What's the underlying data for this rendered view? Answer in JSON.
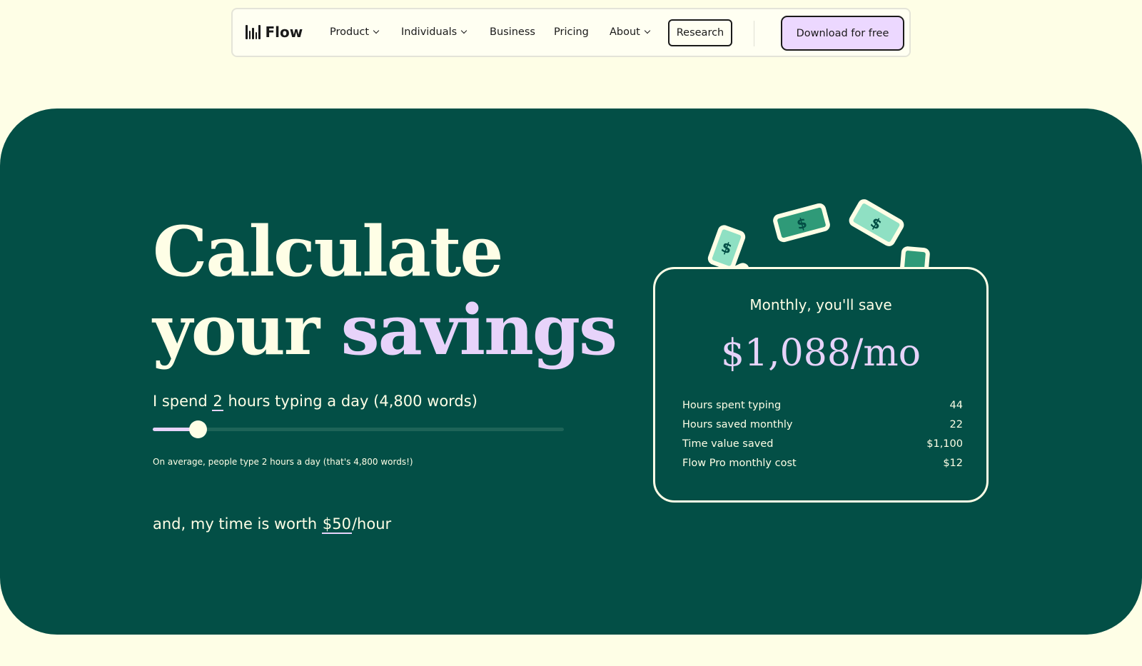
{
  "nav": {
    "brand": "Flow",
    "items": [
      {
        "label": "Product",
        "has_menu": true
      },
      {
        "label": "Individuals",
        "has_menu": true
      },
      {
        "label": "Business",
        "has_menu": false
      },
      {
        "label": "Pricing",
        "has_menu": false
      },
      {
        "label": "About",
        "has_menu": true
      }
    ],
    "research": "Research",
    "download": "Download for free"
  },
  "hero": {
    "title_line1": "Calculate",
    "title_line2_a": "your",
    "title_line2_b": "savings",
    "spend_prefix": "I spend",
    "spend_hours": "2",
    "spend_suffix": "hours typing a day (4,800 words)",
    "slider_fraction": 0.11,
    "avg_note": "On average, people type 2 hours a day (that's 4,800 words!)",
    "worth_prefix": "and, my time is worth",
    "worth_value": "$50",
    "worth_suffix": "/hour"
  },
  "card": {
    "label": "Monthly, you'll save",
    "amount": "$1,088/mo",
    "rows": [
      {
        "label": "Hours spent typing",
        "value": "44"
      },
      {
        "label": "Hours saved monthly",
        "value": "22"
      },
      {
        "label": "Time value saved",
        "value": "$1,100"
      },
      {
        "label": "Flow Pro monthly cost",
        "value": "$12"
      }
    ]
  },
  "illustration": {
    "icon": "juggling-money-person",
    "bill_symbol": "$"
  },
  "colors": {
    "page_bg": "#fefee6",
    "panel_bg": "#034f46",
    "accent_lilac": "#e7d3fa",
    "bill_green": "#2f9a78",
    "bill_mint": "#8fe0c3",
    "cap_orange": "#ee6e4a"
  }
}
